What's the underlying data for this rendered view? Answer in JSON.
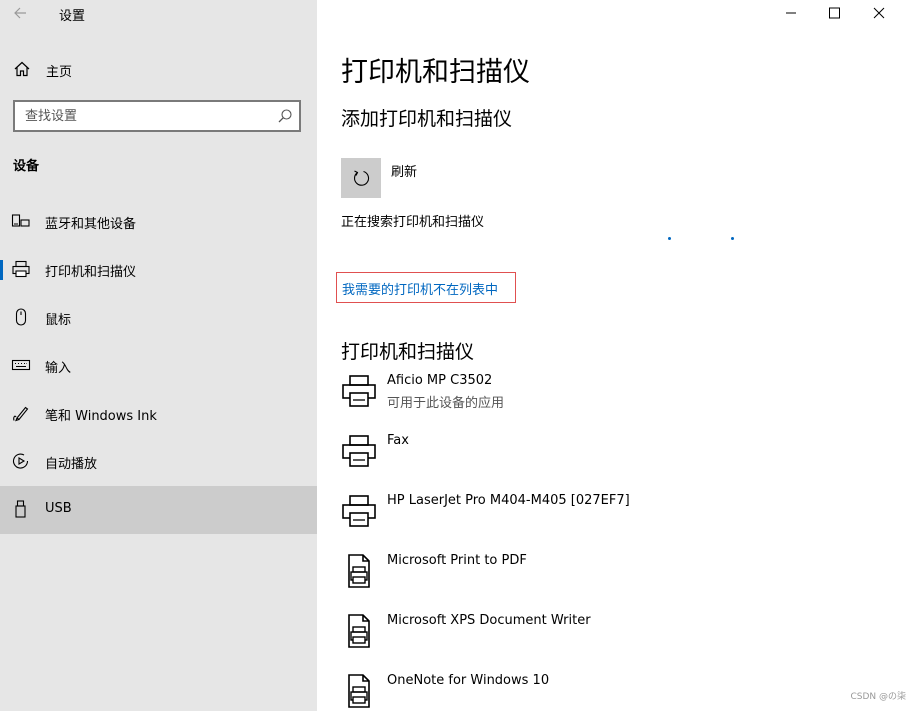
{
  "window": {
    "title": "设置"
  },
  "sidebar": {
    "home_label": "主页",
    "search_placeholder": "查找设置",
    "section_heading": "设备",
    "items": [
      {
        "label": "蓝牙和其他设备",
        "icon": "bluetooth-devices-icon"
      },
      {
        "label": "打印机和扫描仪",
        "icon": "printer-icon",
        "active": true
      },
      {
        "label": "鼠标",
        "icon": "mouse-icon"
      },
      {
        "label": "输入",
        "icon": "keyboard-icon"
      },
      {
        "label": "笔和 Windows Ink",
        "icon": "pen-icon"
      },
      {
        "label": "自动播放",
        "icon": "autoplay-icon"
      },
      {
        "label": "USB",
        "icon": "usb-icon",
        "hovered": true
      }
    ]
  },
  "main": {
    "title": "打印机和扫描仪",
    "add_heading": "添加打印机和扫描仪",
    "refresh_label": "刷新",
    "searching_text": "正在搜索打印机和扫描仪",
    "missing_link": "我需要的打印机不在列表中",
    "list_heading": "打印机和扫描仪",
    "devices": [
      {
        "name": "Aficio MP C3502",
        "status": "可用于此设备的应用",
        "icon": "printer-icon"
      },
      {
        "name": "Fax",
        "status": "",
        "icon": "printer-icon"
      },
      {
        "name": "HP LaserJet Pro M404-M405 [027EF7]",
        "status": "",
        "icon": "printer-icon"
      },
      {
        "name": "Microsoft Print to PDF",
        "status": "",
        "icon": "document-printer-icon"
      },
      {
        "name": "Microsoft XPS Document Writer",
        "status": "",
        "icon": "document-printer-icon"
      },
      {
        "name": "OneNote for Windows 10",
        "status": "",
        "icon": "document-printer-icon"
      }
    ]
  },
  "watermark": "CSDN @の柒",
  "colors": {
    "accent": "#0067c0",
    "sidebar_bg": "#e6e6e6",
    "hover_bg": "#cccccc",
    "highlight_box": "#e05050"
  }
}
